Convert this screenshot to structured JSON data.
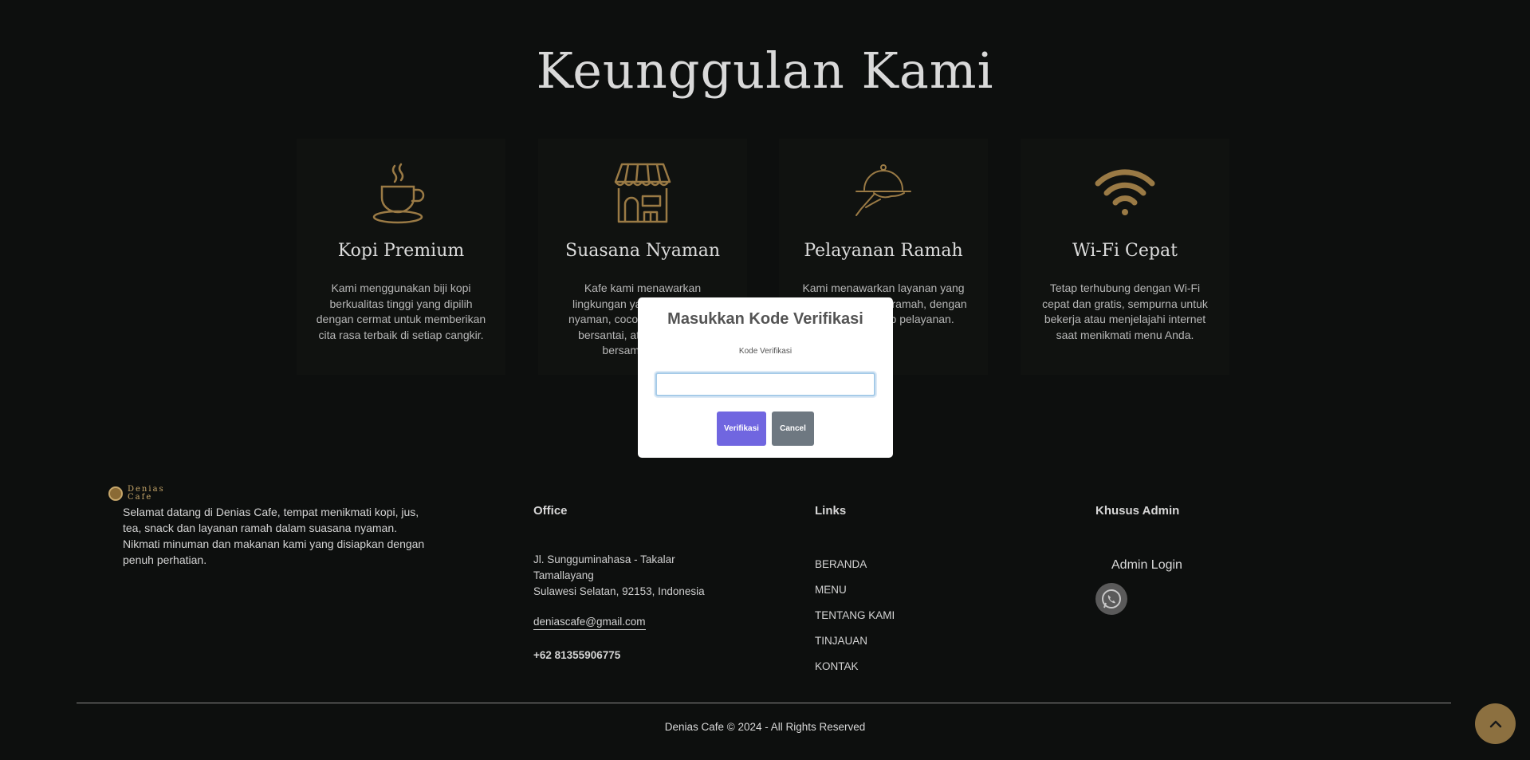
{
  "section": {
    "title": "Keunggulan Kami"
  },
  "features": [
    {
      "title": "Kopi Premium",
      "desc": "Kami menggunakan biji kopi berkualitas tinggi yang dipilih dengan cermat untuk memberikan cita rasa terbaik di setiap cangkir.",
      "icon": "coffee-cup-icon"
    },
    {
      "title": "Suasana Nyaman",
      "desc": "Kafe kami menawarkan lingkungan yang hangat dan nyaman, cocok untuk bekerja, bersantai, atau berkumpul bersama teman.",
      "icon": "storefront-icon"
    },
    {
      "title": "Pelayanan Ramah",
      "desc": "Kami menawarkan layanan yang cepat, sopan, dan ramah, dengan senyum di setiap pelayanan.",
      "icon": "serving-cloche-icon"
    },
    {
      "title": "Wi-Fi Cepat",
      "desc": "Tetap terhubung dengan Wi-Fi cepat dan gratis, sempurna untuk bekerja atau menjelajahi internet saat menikmati menu Anda.",
      "icon": "wifi-icon"
    }
  ],
  "footer": {
    "logo": {
      "line1": "Denias",
      "line2": "Cafe"
    },
    "about": "Selamat datang di Denias Cafe, tempat menikmati kopi, jus, tea, snack dan layanan ramah dalam suasana nyaman. Nikmati minuman dan makanan kami yang disiapkan dengan penuh perhatian.",
    "office": {
      "heading": "Office",
      "address_line1": "Jl. Sungguminahasa - Takalar",
      "address_line2": "Tamallayang",
      "address_line3": "Sulawesi Selatan, 92153, Indonesia",
      "email": "deniascafe@gmail.com",
      "phone": "+62 81355906775"
    },
    "links": {
      "heading": "Links",
      "items": [
        "BERANDA",
        "MENU",
        "TENTANG KAMI",
        "TINJAUAN",
        "KONTAK"
      ]
    },
    "admin": {
      "heading": "Khusus Admin",
      "login": "Admin Login"
    },
    "copyright": "Denias Cafe © 2024 - All Rights Reserved"
  },
  "modal": {
    "title": "Masukkan Kode Verifikasi",
    "label": "Kode Verifikasi",
    "input_value": "",
    "verify_label": "Verifikasi",
    "cancel_label": "Cancel"
  },
  "colors": {
    "accent_gold": "#9a7a45",
    "verify_button": "#7066e0",
    "cancel_button": "#6e7881"
  }
}
